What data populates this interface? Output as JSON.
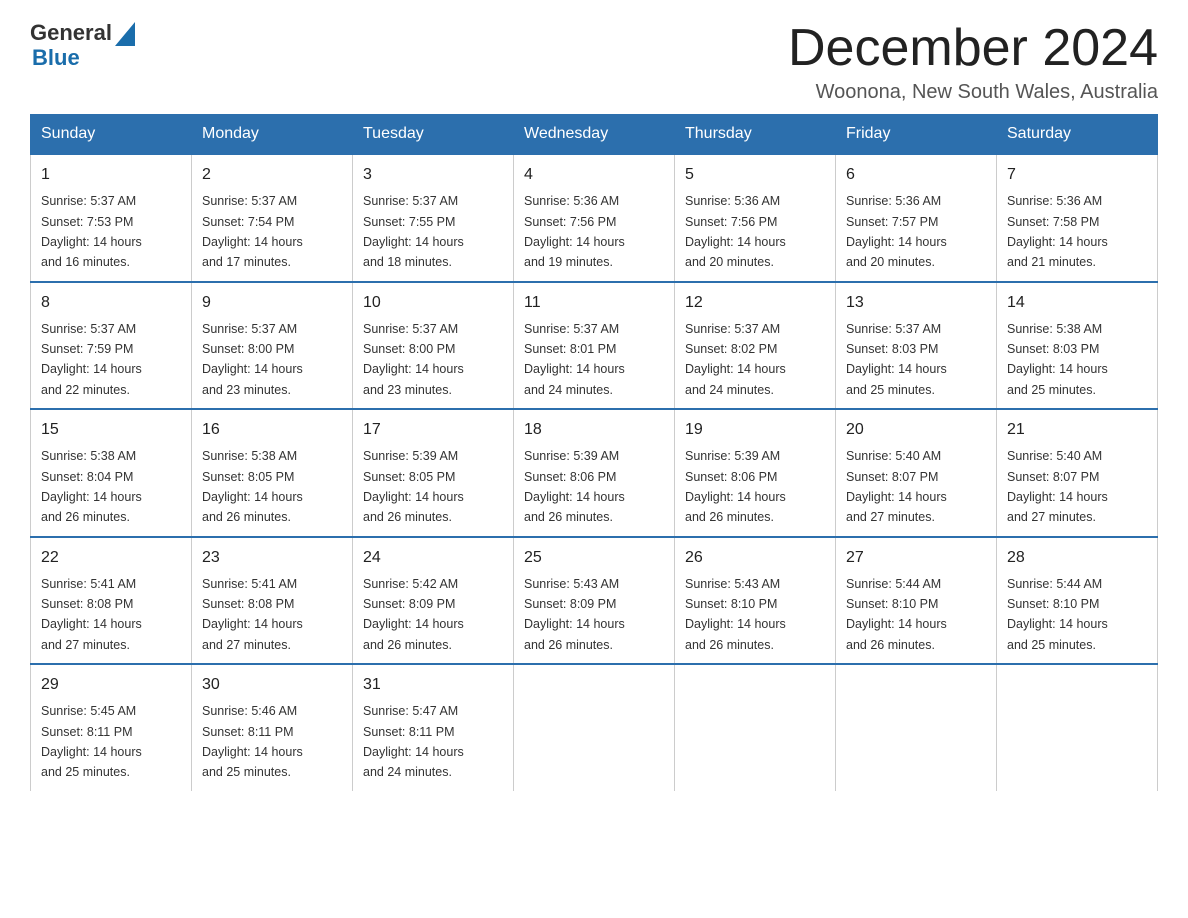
{
  "header": {
    "logo": {
      "text_general": "General",
      "text_blue": "Blue",
      "aria": "GeneralBlue logo"
    },
    "title": "December 2024",
    "location": "Woonona, New South Wales, Australia"
  },
  "days_of_week": [
    "Sunday",
    "Monday",
    "Tuesday",
    "Wednesday",
    "Thursday",
    "Friday",
    "Saturday"
  ],
  "weeks": [
    [
      {
        "day": 1,
        "sunrise": "5:37 AM",
        "sunset": "7:53 PM",
        "daylight": "14 hours and 16 minutes."
      },
      {
        "day": 2,
        "sunrise": "5:37 AM",
        "sunset": "7:54 PM",
        "daylight": "14 hours and 17 minutes."
      },
      {
        "day": 3,
        "sunrise": "5:37 AM",
        "sunset": "7:55 PM",
        "daylight": "14 hours and 18 minutes."
      },
      {
        "day": 4,
        "sunrise": "5:36 AM",
        "sunset": "7:56 PM",
        "daylight": "14 hours and 19 minutes."
      },
      {
        "day": 5,
        "sunrise": "5:36 AM",
        "sunset": "7:56 PM",
        "daylight": "14 hours and 20 minutes."
      },
      {
        "day": 6,
        "sunrise": "5:36 AM",
        "sunset": "7:57 PM",
        "daylight": "14 hours and 20 minutes."
      },
      {
        "day": 7,
        "sunrise": "5:36 AM",
        "sunset": "7:58 PM",
        "daylight": "14 hours and 21 minutes."
      }
    ],
    [
      {
        "day": 8,
        "sunrise": "5:37 AM",
        "sunset": "7:59 PM",
        "daylight": "14 hours and 22 minutes."
      },
      {
        "day": 9,
        "sunrise": "5:37 AM",
        "sunset": "8:00 PM",
        "daylight": "14 hours and 23 minutes."
      },
      {
        "day": 10,
        "sunrise": "5:37 AM",
        "sunset": "8:00 PM",
        "daylight": "14 hours and 23 minutes."
      },
      {
        "day": 11,
        "sunrise": "5:37 AM",
        "sunset": "8:01 PM",
        "daylight": "14 hours and 24 minutes."
      },
      {
        "day": 12,
        "sunrise": "5:37 AM",
        "sunset": "8:02 PM",
        "daylight": "14 hours and 24 minutes."
      },
      {
        "day": 13,
        "sunrise": "5:37 AM",
        "sunset": "8:03 PM",
        "daylight": "14 hours and 25 minutes."
      },
      {
        "day": 14,
        "sunrise": "5:38 AM",
        "sunset": "8:03 PM",
        "daylight": "14 hours and 25 minutes."
      }
    ],
    [
      {
        "day": 15,
        "sunrise": "5:38 AM",
        "sunset": "8:04 PM",
        "daylight": "14 hours and 26 minutes."
      },
      {
        "day": 16,
        "sunrise": "5:38 AM",
        "sunset": "8:05 PM",
        "daylight": "14 hours and 26 minutes."
      },
      {
        "day": 17,
        "sunrise": "5:39 AM",
        "sunset": "8:05 PM",
        "daylight": "14 hours and 26 minutes."
      },
      {
        "day": 18,
        "sunrise": "5:39 AM",
        "sunset": "8:06 PM",
        "daylight": "14 hours and 26 minutes."
      },
      {
        "day": 19,
        "sunrise": "5:39 AM",
        "sunset": "8:06 PM",
        "daylight": "14 hours and 26 minutes."
      },
      {
        "day": 20,
        "sunrise": "5:40 AM",
        "sunset": "8:07 PM",
        "daylight": "14 hours and 27 minutes."
      },
      {
        "day": 21,
        "sunrise": "5:40 AM",
        "sunset": "8:07 PM",
        "daylight": "14 hours and 27 minutes."
      }
    ],
    [
      {
        "day": 22,
        "sunrise": "5:41 AM",
        "sunset": "8:08 PM",
        "daylight": "14 hours and 27 minutes."
      },
      {
        "day": 23,
        "sunrise": "5:41 AM",
        "sunset": "8:08 PM",
        "daylight": "14 hours and 27 minutes."
      },
      {
        "day": 24,
        "sunrise": "5:42 AM",
        "sunset": "8:09 PM",
        "daylight": "14 hours and 26 minutes."
      },
      {
        "day": 25,
        "sunrise": "5:43 AM",
        "sunset": "8:09 PM",
        "daylight": "14 hours and 26 minutes."
      },
      {
        "day": 26,
        "sunrise": "5:43 AM",
        "sunset": "8:10 PM",
        "daylight": "14 hours and 26 minutes."
      },
      {
        "day": 27,
        "sunrise": "5:44 AM",
        "sunset": "8:10 PM",
        "daylight": "14 hours and 26 minutes."
      },
      {
        "day": 28,
        "sunrise": "5:44 AM",
        "sunset": "8:10 PM",
        "daylight": "14 hours and 25 minutes."
      }
    ],
    [
      {
        "day": 29,
        "sunrise": "5:45 AM",
        "sunset": "8:11 PM",
        "daylight": "14 hours and 25 minutes."
      },
      {
        "day": 30,
        "sunrise": "5:46 AM",
        "sunset": "8:11 PM",
        "daylight": "14 hours and 25 minutes."
      },
      {
        "day": 31,
        "sunrise": "5:47 AM",
        "sunset": "8:11 PM",
        "daylight": "14 hours and 24 minutes."
      },
      null,
      null,
      null,
      null
    ]
  ],
  "labels": {
    "sunrise": "Sunrise:",
    "sunset": "Sunset:",
    "daylight": "Daylight:"
  }
}
